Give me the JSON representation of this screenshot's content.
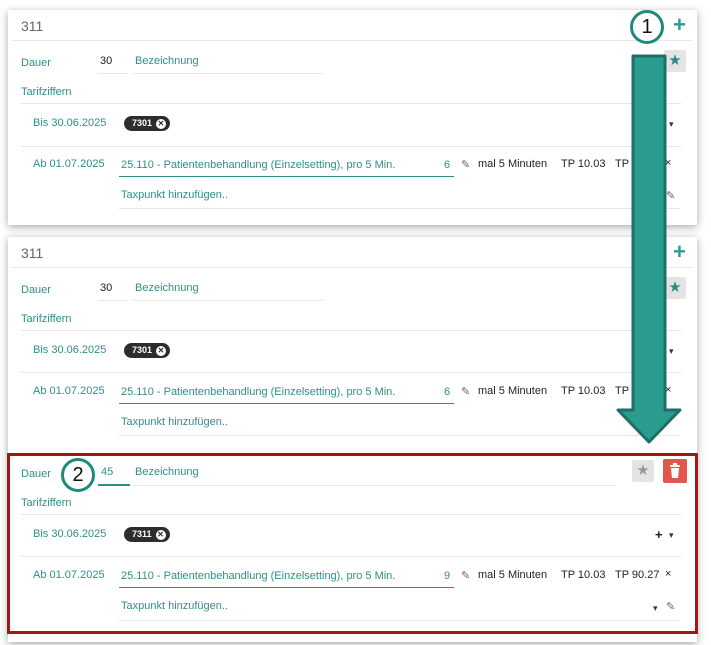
{
  "panels": [
    {
      "title": "311",
      "dauer_label": "Dauer",
      "dauer_value": "30",
      "bezeichnung_label": "Bezeichnung",
      "tarifziffern_label": "Tarifziffern",
      "row1": {
        "label": "Bis 30.06.2025",
        "tag": "7301"
      },
      "row2": {
        "label": "Ab 01.07.2025",
        "item": "25.110 - Patientenbehandlung (Einzelsetting), pro 5 Min.",
        "count": "6",
        "mult": "mal 5 Minuten",
        "tp_rate": "TP 10.03",
        "tp_total": "TP"
      },
      "add_placeholder": "Taxpunkt hinzufügen.."
    },
    {
      "title": "311",
      "dauer_label": "Dauer",
      "dauer_value": "30",
      "bezeichnung_label": "Bezeichnung",
      "tarifziffern_label": "Tarifziffern",
      "row1": {
        "label": "Bis 30.06.2025",
        "tag": "7301"
      },
      "row2": {
        "label": "Ab 01.07.2025",
        "item": "25.110 - Patientenbehandlung (Einzelsetting), pro 5 Min.",
        "count": "6",
        "mult": "mal 5 Minuten",
        "tp_rate": "TP 10.03",
        "tp_total": "TP"
      },
      "add_placeholder": "Taxpunkt hinzufügen.."
    }
  ],
  "new_entry": {
    "dauer_label": "Dauer",
    "dauer_value": "45",
    "bezeichnung_label": "Bezeichnung",
    "tarifziffern_label": "Tarifziffern",
    "row1": {
      "label": "Bis 30.06.2025",
      "tag": "7311"
    },
    "row2": {
      "label": "Ab 01.07.2025",
      "item": "25.110 - Patientenbehandlung (Einzelsetting), pro 5 Min.",
      "count": "9",
      "mult": "mal 5 Minuten",
      "tp_rate": "TP 10.03",
      "tp_total": "TP 90.27"
    },
    "add_placeholder": "Taxpunkt hinzufügen.."
  },
  "annotations": {
    "step1": "1",
    "step2": "2"
  },
  "icons": {
    "plus": "+",
    "star": "★",
    "remove": "×",
    "pencil": "✎",
    "caret": "▾"
  },
  "colors": {
    "teal": "#2f8f87",
    "arrow": "#2a9d8f",
    "highlight_border": "#a01919",
    "delete": "#e2574c"
  }
}
